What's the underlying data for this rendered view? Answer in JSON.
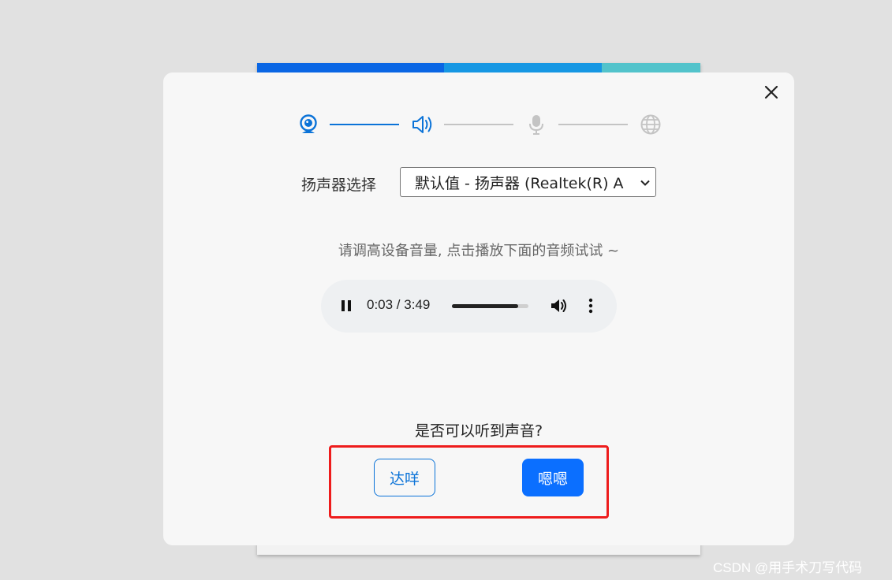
{
  "colors": {
    "backdrop_stripe_1": "#0a66e4",
    "backdrop_stripe_2": "#1697e3",
    "backdrop_stripe_3": "#52c3cb",
    "step_active": "#0b73d8",
    "step_inactive": "#c4c4c4",
    "primary_button": "#0b6fff",
    "highlight_border": "#ee1c1c"
  },
  "steps": [
    {
      "name": "camera",
      "icon": "webcam-icon",
      "state": "done"
    },
    {
      "name": "speaker",
      "icon": "speaker-icon",
      "state": "active"
    },
    {
      "name": "microphone",
      "icon": "microphone-icon",
      "state": "pending"
    },
    {
      "name": "network",
      "icon": "globe-icon",
      "state": "pending"
    }
  ],
  "speaker": {
    "label": "扬声器选择",
    "selected": "默认值 - 扬声器 (Realtek(R) A"
  },
  "hint": "请调高设备音量, 点击播放下面的音频试试 ~",
  "audio": {
    "time": "0:03 / 3:49",
    "progress_fraction": 0.87,
    "state": "playing"
  },
  "question": "是否可以听到声音?",
  "buttons": {
    "no": "达咩",
    "yes": "嗯嗯"
  },
  "watermark": "CSDN @用手术刀写代码"
}
